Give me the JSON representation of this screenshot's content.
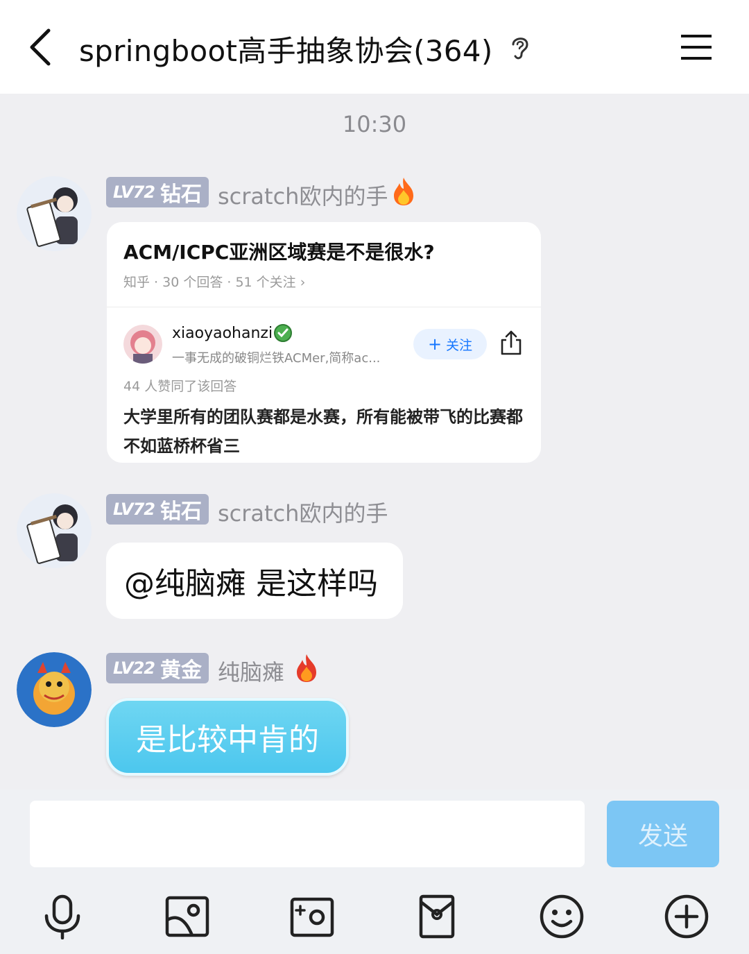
{
  "header": {
    "title": "springboot高手抽象协会(364)"
  },
  "chat": {
    "time": "10:30",
    "messages": [
      {
        "level": "LV72",
        "rank": "钻石",
        "nickname": "scratch欧内的手",
        "card": {
          "question": "ACM/ICPC亚洲区域赛是不是很水?",
          "meta": "知乎 · 30 个回答 · 51 个关注  ›",
          "author": "xiaoyaohanzi",
          "bio": "一事无成的破铜烂铁ACMer,简称ac...",
          "follow_label": "关注",
          "likes": "44 人赞同了该回答",
          "answer": "大学里所有的团队赛都是水赛，所有能被带飞的比赛都不如蓝桥杯省三"
        }
      },
      {
        "level": "LV72",
        "rank": "钻石",
        "nickname": "scratch欧内的手",
        "text": "@纯脑瘫 是这样吗"
      },
      {
        "level": "LV22",
        "rank": "黄金",
        "nickname": "纯脑瘫",
        "text": "是比较中肯的"
      }
    ]
  },
  "composer": {
    "input_value": "",
    "send_label": "发送"
  },
  "toolbar": {
    "icons": [
      "microphone-icon",
      "image-icon",
      "camera-icon",
      "red-packet-icon",
      "emoji-icon",
      "plus-icon"
    ]
  }
}
